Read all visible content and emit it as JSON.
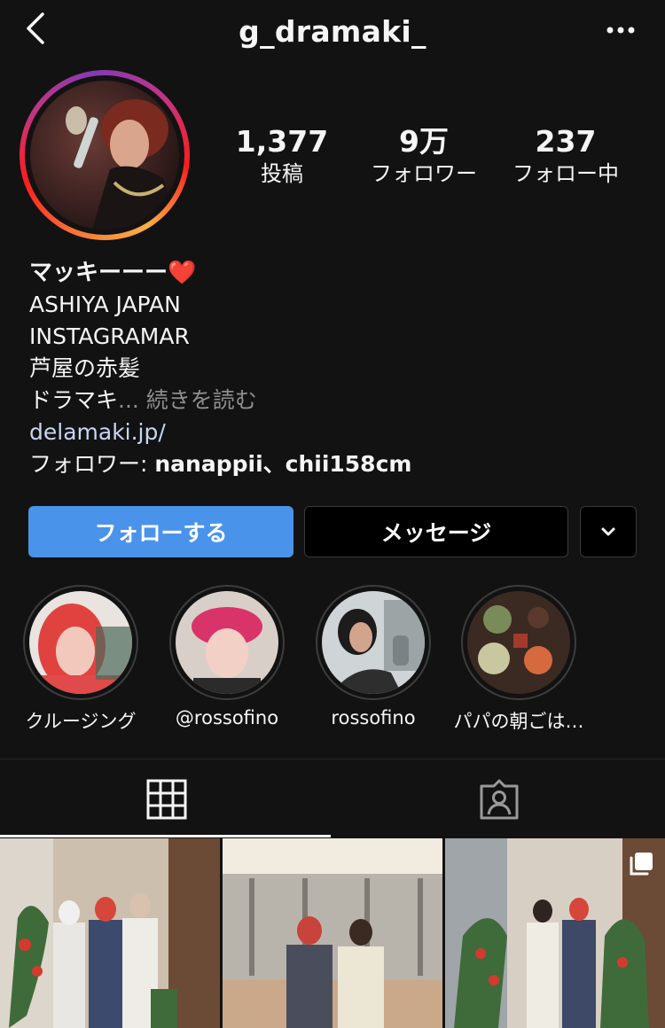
{
  "header": {
    "username": "g_dramaki_",
    "icons": [
      "chevron-left-icon",
      "more-dots-icon"
    ]
  },
  "stats": [
    {
      "value": "1,377",
      "label": "投稿"
    },
    {
      "value": "9万",
      "label": "フォロワー"
    },
    {
      "value": "237",
      "label": "フォロー中"
    }
  ],
  "bio": {
    "name": "マッキーーー❤️",
    "lines": [
      "ASHIYA  JAPAN",
      "INSTAGRAMAR",
      "芦屋の赤髪"
    ],
    "last_line": "ドラマキ",
    "more_label": "... 続きを読む",
    "website": "delamaki.jp/",
    "followed_by_prefix": "フォロワー: ",
    "followed_by_names": "nanappii、chii158cm"
  },
  "actions": {
    "follow": "フォローする",
    "message": "メッセージ",
    "icons": [
      "chevron-down-icon"
    ]
  },
  "highlights": [
    {
      "label": "クルージング"
    },
    {
      "label": "@rossofino"
    },
    {
      "label": "rossofino"
    },
    {
      "label": "パパの朝ごは…"
    }
  ],
  "tabs": [
    "grid-icon",
    "tagged-person-icon"
  ],
  "colors": {
    "background": "#121212",
    "follow_button": "#4a93ea",
    "link": "#c7d6f2",
    "muted": "#8e8e8e"
  }
}
